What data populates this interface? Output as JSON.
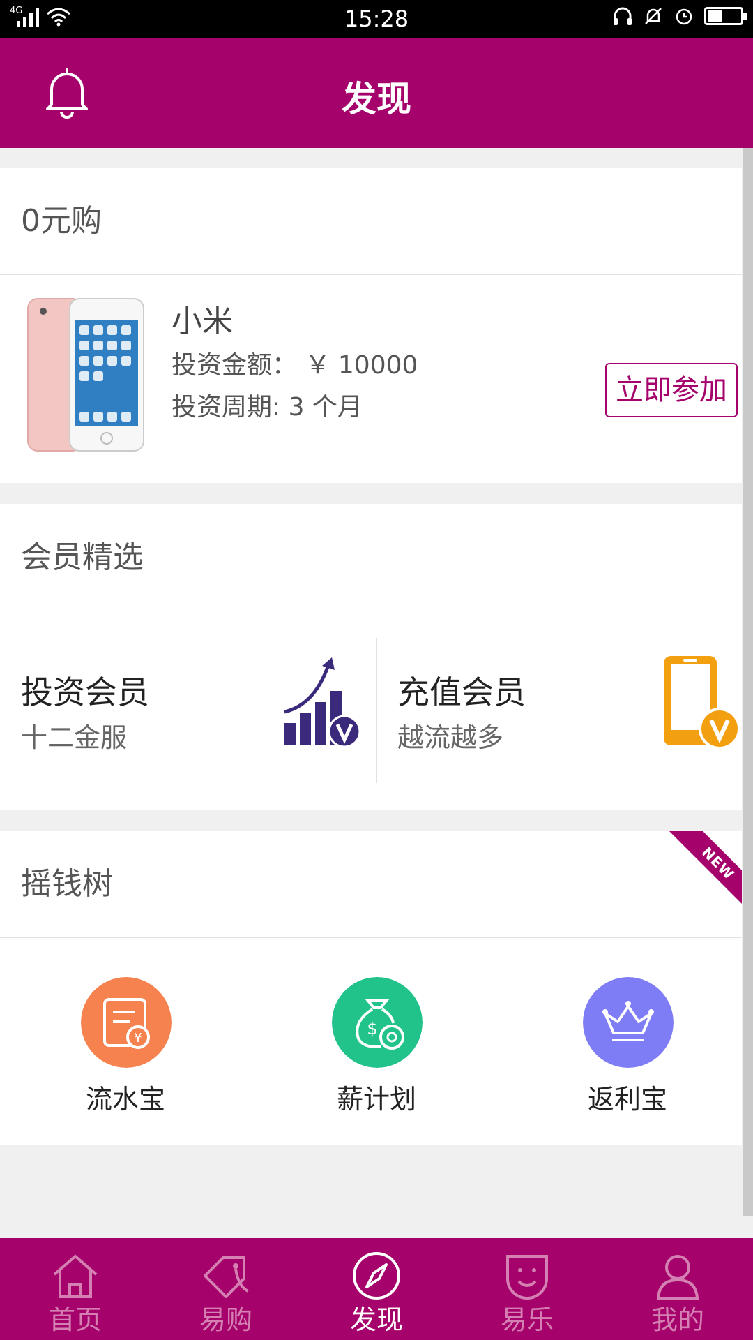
{
  "status_bar": {
    "time": "15:28",
    "network": "4G"
  },
  "header": {
    "title": "发现"
  },
  "zero_buy": {
    "title": "0元购",
    "product": {
      "name": "小米",
      "amount": "投资金额： ￥ 10000",
      "period": "投资周期: 3 个月",
      "join_label": "立即参加"
    }
  },
  "members": {
    "title": "会员精选",
    "items": [
      {
        "title": "投资会员",
        "subtitle": "十二金服",
        "icon": "chart-vip-icon"
      },
      {
        "title": "充值会员",
        "subtitle": "越流越多",
        "icon": "phone-vip-icon"
      }
    ]
  },
  "money_tree": {
    "title": "摇钱树",
    "badge": "NEW",
    "items": [
      {
        "label": "流水宝",
        "icon": "bill-icon",
        "color": "#f6834f"
      },
      {
        "label": "薪计划",
        "icon": "money-bag-icon",
        "color": "#21c38a"
      },
      {
        "label": "返利宝",
        "icon": "crown-icon",
        "color": "#7f7df5"
      }
    ]
  },
  "bottom_nav": {
    "active": "发现",
    "items": [
      {
        "label": "首页",
        "icon": "home-icon"
      },
      {
        "label": "易购",
        "icon": "tag-icon"
      },
      {
        "label": "发现",
        "icon": "compass-icon"
      },
      {
        "label": "易乐",
        "icon": "smile-icon"
      },
      {
        "label": "我的",
        "icon": "user-icon"
      }
    ]
  },
  "colors": {
    "brand": "#a5036b",
    "background": "#f0f0f0"
  }
}
